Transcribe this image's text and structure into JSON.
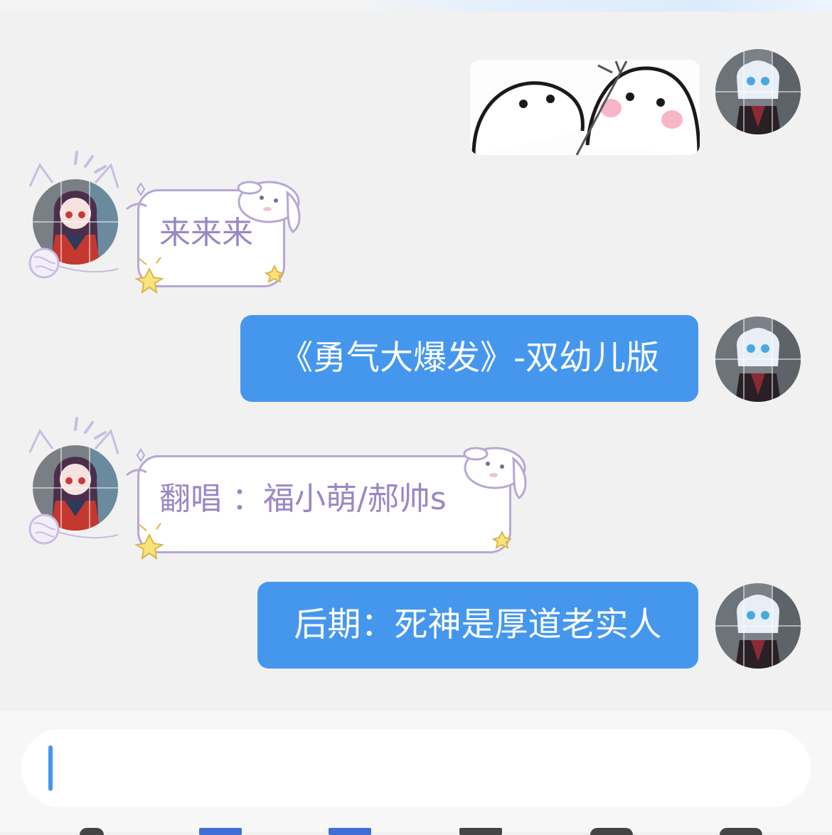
{
  "messages": [
    {
      "id": "m1",
      "sender": "me",
      "kind": "sticker"
    },
    {
      "id": "m2",
      "sender": "other",
      "kind": "text",
      "text": "来来来"
    },
    {
      "id": "m3",
      "sender": "me",
      "kind": "text",
      "text": "《勇气大爆发》-双幼儿版"
    },
    {
      "id": "m4",
      "sender": "other",
      "kind": "text",
      "text": "翻唱 ：福小萌/郝帅s"
    },
    {
      "id": "m5",
      "sender": "me",
      "kind": "text",
      "text": "后期：死神是厚道老实人"
    }
  ],
  "input": {
    "value": "",
    "placeholder": ""
  },
  "colors": {
    "background": "#f1f1f1",
    "my_bubble": "#4597ee",
    "my_text": "#ffffff",
    "other_bubble_border": "#b7a7d4",
    "other_text": "#9a87c4",
    "input_caret": "#4597ee"
  },
  "icons": [
    "avatar-me",
    "avatar-other",
    "ghost-sticker",
    "cat-ear-frame",
    "bunny-decoration",
    "star-decoration",
    "yarn-ball-decoration"
  ]
}
